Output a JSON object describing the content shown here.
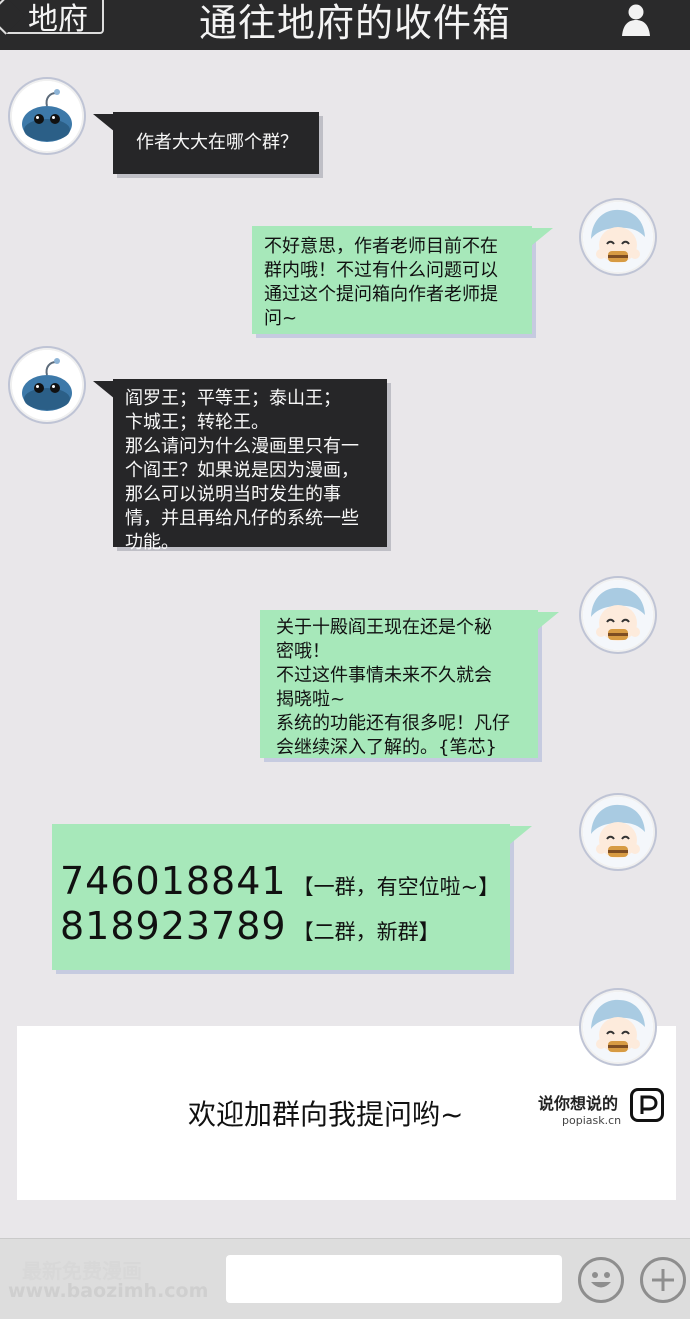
{
  "header": {
    "back_label": "地府",
    "title": "通往地府的收件箱"
  },
  "messages": [
    {
      "text": "作者大大在哪个群？"
    },
    {
      "text": "不好意思，作者老师目前不在\n群内哦！不过有什么问题可以\n通过这个提问箱向作者老师提\n问~"
    },
    {
      "text": "阎罗王；平等王；泰山王；\n卞城王；转轮王。\n那么请问为什么漫画里只有一\n个阎王？如果说是因为漫画，\n那么可以说明当时发生的事\n情，并且再给凡仔的系统一些\n功能。"
    },
    {
      "text": "关于十殿阎王现在还是个秘\n密哦！\n不过这件事情未来不久就会\n揭晓啦~\n系统的功能还有很多呢！凡仔\n会继续深入了解的。{笔芯}"
    }
  ],
  "groups": [
    {
      "number": "746018841",
      "note": "【一群，有空位啦~】"
    },
    {
      "number": "818923789",
      "note": "【二群，新群】"
    }
  ],
  "promo": {
    "text": "欢迎加群向我提问哟~",
    "logo_text": "说你想说的",
    "logo_sub": "popiask.cn"
  },
  "watermark": {
    "line1": "最新免费漫画",
    "line2": "www.baozimh.com"
  },
  "colors": {
    "header": "#2a2a2b",
    "dark_bubble": "#262628",
    "green_bubble": "#a7e8ba",
    "background": "#e9e7ea"
  }
}
